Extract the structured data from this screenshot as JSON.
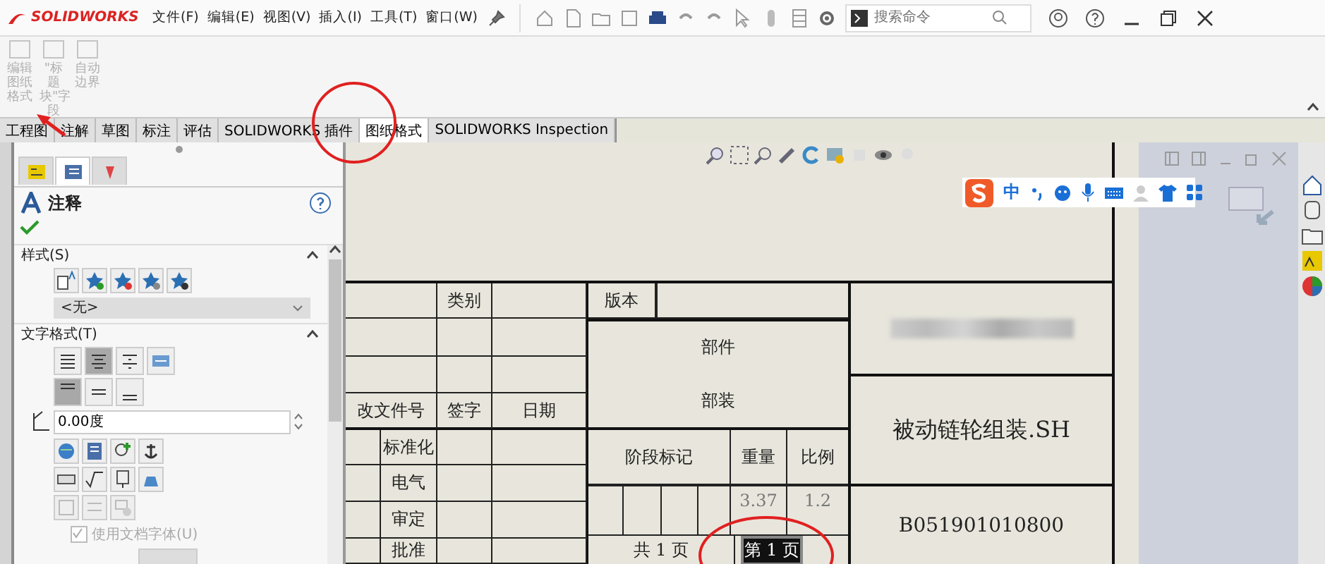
{
  "app": {
    "logo": "SOLIDWORKS"
  },
  "menu": [
    "文件(F)",
    "编辑(E)",
    "视图(V)",
    "插入(I)",
    "工具(T)",
    "窗口(W)"
  ],
  "search": {
    "placeholder": "搜索命令"
  },
  "ribbon": {
    "buttons": [
      {
        "label": "编辑图纸格式",
        "disabled": true
      },
      {
        "label": "\"标题块\"字段",
        "disabled": true
      },
      {
        "label": "自动边界",
        "disabled": true
      }
    ]
  },
  "tabs": [
    {
      "label": "工程图",
      "selected": false
    },
    {
      "label": "注解",
      "selected": false
    },
    {
      "label": "草图",
      "selected": false
    },
    {
      "label": "标注",
      "selected": false
    },
    {
      "label": "评估",
      "selected": false
    },
    {
      "label": "SOLIDWORKS 插件",
      "selected": false
    },
    {
      "label": "图纸格式",
      "selected": true
    },
    {
      "label": "SOLIDWORKS Inspection",
      "selected": false
    }
  ],
  "property_manager": {
    "tabs": [
      {
        "selected": false
      },
      {
        "selected": true
      },
      {
        "selected": false
      }
    ],
    "title": "注释",
    "style_section": {
      "title": "样式(S)",
      "expanded": true,
      "style_value": "<无>"
    },
    "text_format_section": {
      "title": "文字格式(T)",
      "expanded": true,
      "justify_buttons": [
        {
          "selected": false
        },
        {
          "selected": true
        },
        {
          "selected": false
        },
        {
          "selected": false
        }
      ],
      "vertical_buttons": [
        {
          "selected": true
        },
        {
          "selected": false
        },
        {
          "selected": false
        }
      ],
      "angle": "0.00度",
      "use_document_font": {
        "label": "使用文档字体(U)",
        "checked": true,
        "disabled": true
      }
    }
  },
  "ime_toolbar": {
    "mode": "中"
  },
  "title_block": {
    "category_label": "类别",
    "change_doc_label": "改文件号",
    "signature_label": "签字",
    "date_label": "日期",
    "roles": [
      "标准化",
      "电气",
      "审定",
      "批准"
    ],
    "version_label": "版本",
    "part_label": "部件",
    "assembly_label": "部装",
    "stage_label": "阶段标记",
    "weight_label": "重量",
    "scale_label": "比例",
    "weight": "3.37",
    "scale": "1.2",
    "total_sheets": "共 1 页",
    "sheet": "第 1 页",
    "sheet_selected": true,
    "title": "被动链轮组装.SH",
    "drawing_number": "B051901010800"
  }
}
